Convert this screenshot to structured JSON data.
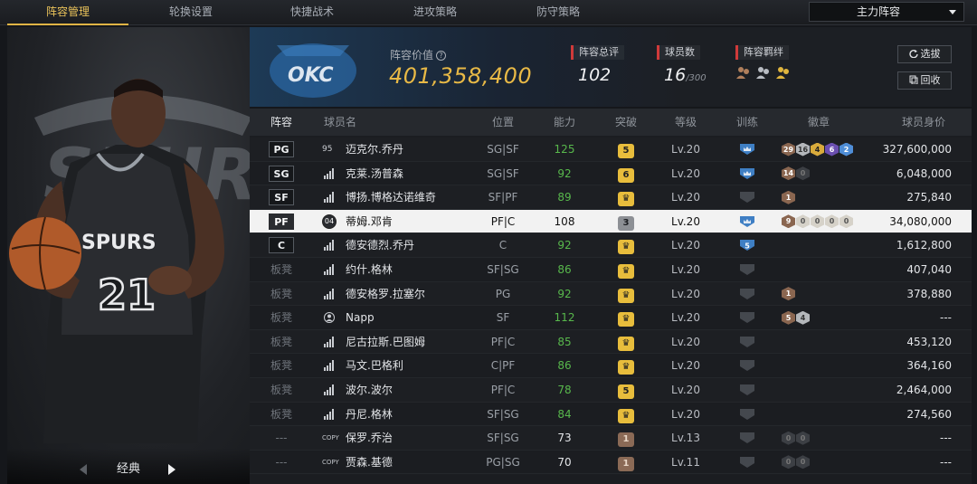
{
  "tabs": [
    {
      "label": "阵容管理",
      "active": true
    },
    {
      "label": "轮换设置",
      "active": false
    },
    {
      "label": "快捷战术",
      "active": false
    },
    {
      "label": "进攻策略",
      "active": false
    },
    {
      "label": "防守策略",
      "active": false
    }
  ],
  "lineup_select": {
    "value": "主力阵容"
  },
  "left_panel": {
    "jersey_team": "SPURS",
    "jersey_number": "21",
    "style_label": "经典"
  },
  "summary": {
    "team_logo_text": "OKC",
    "value_label": "阵容价值",
    "value": "401,358,400",
    "rating_label": "阵容总评",
    "rating": "102",
    "count_label": "球员数",
    "count": "16",
    "count_max": "/300",
    "bond_label": "阵容羁绊",
    "btn_scout": "选拔",
    "btn_recycle": "回收"
  },
  "columns": [
    "阵容",
    "球员名",
    "位置",
    "能力",
    "突破",
    "等级",
    "训练",
    "徽章",
    "球员身价"
  ],
  "rows": [
    {
      "slot": "PG",
      "starter": true,
      "tag": "95",
      "tag_type": "num",
      "name": "迈克尔.乔丹",
      "pos": "SG|SF",
      "ovr": "125",
      "ovr_color": "green",
      "brk": "5",
      "brk_type": "gold",
      "lv": "Lv.20",
      "train": "crown-blue",
      "badges": [
        [
          "b-bronze",
          "29"
        ],
        [
          "b-silver",
          "16"
        ],
        [
          "b-gold",
          "4"
        ],
        [
          "b-purple",
          "6"
        ],
        [
          "b-blue",
          "2"
        ]
      ],
      "price": "327,600,000"
    },
    {
      "slot": "SG",
      "starter": true,
      "tag": "",
      "tag_type": "bars",
      "name": "克莱.汤普森",
      "pos": "SG|SF",
      "ovr": "92",
      "ovr_color": "green",
      "brk": "6",
      "brk_type": "gold",
      "lv": "Lv.20",
      "train": "crown-blue",
      "badges": [
        [
          "b-bronze",
          "14"
        ],
        [
          "b-dim",
          "0"
        ]
      ],
      "price": "6,048,000"
    },
    {
      "slot": "SF",
      "starter": true,
      "tag": "",
      "tag_type": "bars",
      "name": "博扬.博格达诺维奇",
      "pos": "SF|PF",
      "ovr": "89",
      "ovr_color": "green",
      "brk": "♛",
      "brk_type": "crown",
      "lv": "Lv.20",
      "train": "dim",
      "badges": [
        [
          "b-bronze",
          "1"
        ]
      ],
      "price": "275,840"
    },
    {
      "slot": "PF",
      "starter": true,
      "selected": true,
      "tag": "04",
      "tag_type": "circ",
      "name": "蒂姆.邓肯",
      "pos": "PF|C",
      "ovr": "108",
      "ovr_color": "white",
      "brk": "3",
      "brk_type": "silver",
      "lv": "Lv.20",
      "train": "crown-blue",
      "badges": [
        [
          "b-bronze",
          "9"
        ],
        [
          "b-light",
          "0"
        ],
        [
          "b-light",
          "0"
        ],
        [
          "b-light",
          "0"
        ],
        [
          "b-light",
          "0"
        ]
      ],
      "price": "34,080,000"
    },
    {
      "slot": "C",
      "starter": true,
      "tag": "",
      "tag_type": "bars",
      "name": "德安德烈.乔丹",
      "pos": "C",
      "ovr": "92",
      "ovr_color": "green",
      "brk": "♛",
      "brk_type": "crown",
      "lv": "Lv.20",
      "train": "blue5",
      "badges": [],
      "price": "1,612,800"
    },
    {
      "slot": "板凳",
      "starter": false,
      "tag": "",
      "tag_type": "bars",
      "name": "约什.格林",
      "pos": "SF|SG",
      "ovr": "86",
      "ovr_color": "green",
      "brk": "♛",
      "brk_type": "crown",
      "lv": "Lv.20",
      "train": "dim",
      "badges": [],
      "price": "407,040"
    },
    {
      "slot": "板凳",
      "starter": false,
      "tag": "",
      "tag_type": "bars",
      "name": "德安格罗.拉塞尔",
      "pos": "PG",
      "ovr": "92",
      "ovr_color": "green",
      "brk": "♛",
      "brk_type": "crown",
      "lv": "Lv.20",
      "train": "dim",
      "badges": [
        [
          "b-bronze",
          "1"
        ]
      ],
      "price": "378,880"
    },
    {
      "slot": "板凳",
      "starter": false,
      "tag": "",
      "tag_type": "person",
      "name": "Napp",
      "pos": "SF",
      "ovr": "112",
      "ovr_color": "green",
      "brk": "♛",
      "brk_type": "crown",
      "lv": "Lv.20",
      "train": "dim",
      "badges": [
        [
          "b-bronze",
          "5"
        ],
        [
          "b-silver",
          "4"
        ]
      ],
      "price": "---"
    },
    {
      "slot": "板凳",
      "starter": false,
      "tag": "",
      "tag_type": "bars",
      "name": "尼古拉斯.巴图姆",
      "pos": "PF|C",
      "ovr": "85",
      "ovr_color": "green",
      "brk": "♛",
      "brk_type": "crown",
      "lv": "Lv.20",
      "train": "dim",
      "badges": [],
      "price": "453,120"
    },
    {
      "slot": "板凳",
      "starter": false,
      "tag": "",
      "tag_type": "bars",
      "name": "马文.巴格利",
      "pos": "C|PF",
      "ovr": "86",
      "ovr_color": "green",
      "brk": "♛",
      "brk_type": "crown",
      "lv": "Lv.20",
      "train": "dim",
      "badges": [],
      "price": "364,160"
    },
    {
      "slot": "板凳",
      "starter": false,
      "tag": "",
      "tag_type": "bars",
      "name": "波尔.波尔",
      "pos": "PF|C",
      "ovr": "78",
      "ovr_color": "green",
      "brk": "5",
      "brk_type": "gold",
      "lv": "Lv.20",
      "train": "dim",
      "badges": [],
      "price": "2,464,000"
    },
    {
      "slot": "板凳",
      "starter": false,
      "tag": "",
      "tag_type": "bars",
      "name": "丹尼.格林",
      "pos": "SF|SG",
      "ovr": "84",
      "ovr_color": "green",
      "brk": "♛",
      "brk_type": "crown",
      "lv": "Lv.20",
      "train": "dim",
      "badges": [],
      "price": "274,560"
    },
    {
      "slot": "---",
      "starter": false,
      "tag": "COPY",
      "tag_type": "copy",
      "name": "保罗.乔治",
      "pos": "SF|SG",
      "ovr": "73",
      "ovr_color": "white",
      "brk": "1",
      "brk_type": "bronze",
      "lv": "Lv.13",
      "train": "dim",
      "badges": [
        [
          "b-dim",
          "0"
        ],
        [
          "b-dim",
          "0"
        ]
      ],
      "price": "---"
    },
    {
      "slot": "---",
      "starter": false,
      "tag": "COPY",
      "tag_type": "copy",
      "name": "贾森.基德",
      "pos": "PG|SG",
      "ovr": "70",
      "ovr_color": "white",
      "brk": "1",
      "brk_type": "bronze",
      "lv": "Lv.11",
      "train": "dim",
      "badges": [
        [
          "b-dim",
          "0"
        ],
        [
          "b-dim",
          "0"
        ]
      ],
      "price": "---"
    }
  ]
}
